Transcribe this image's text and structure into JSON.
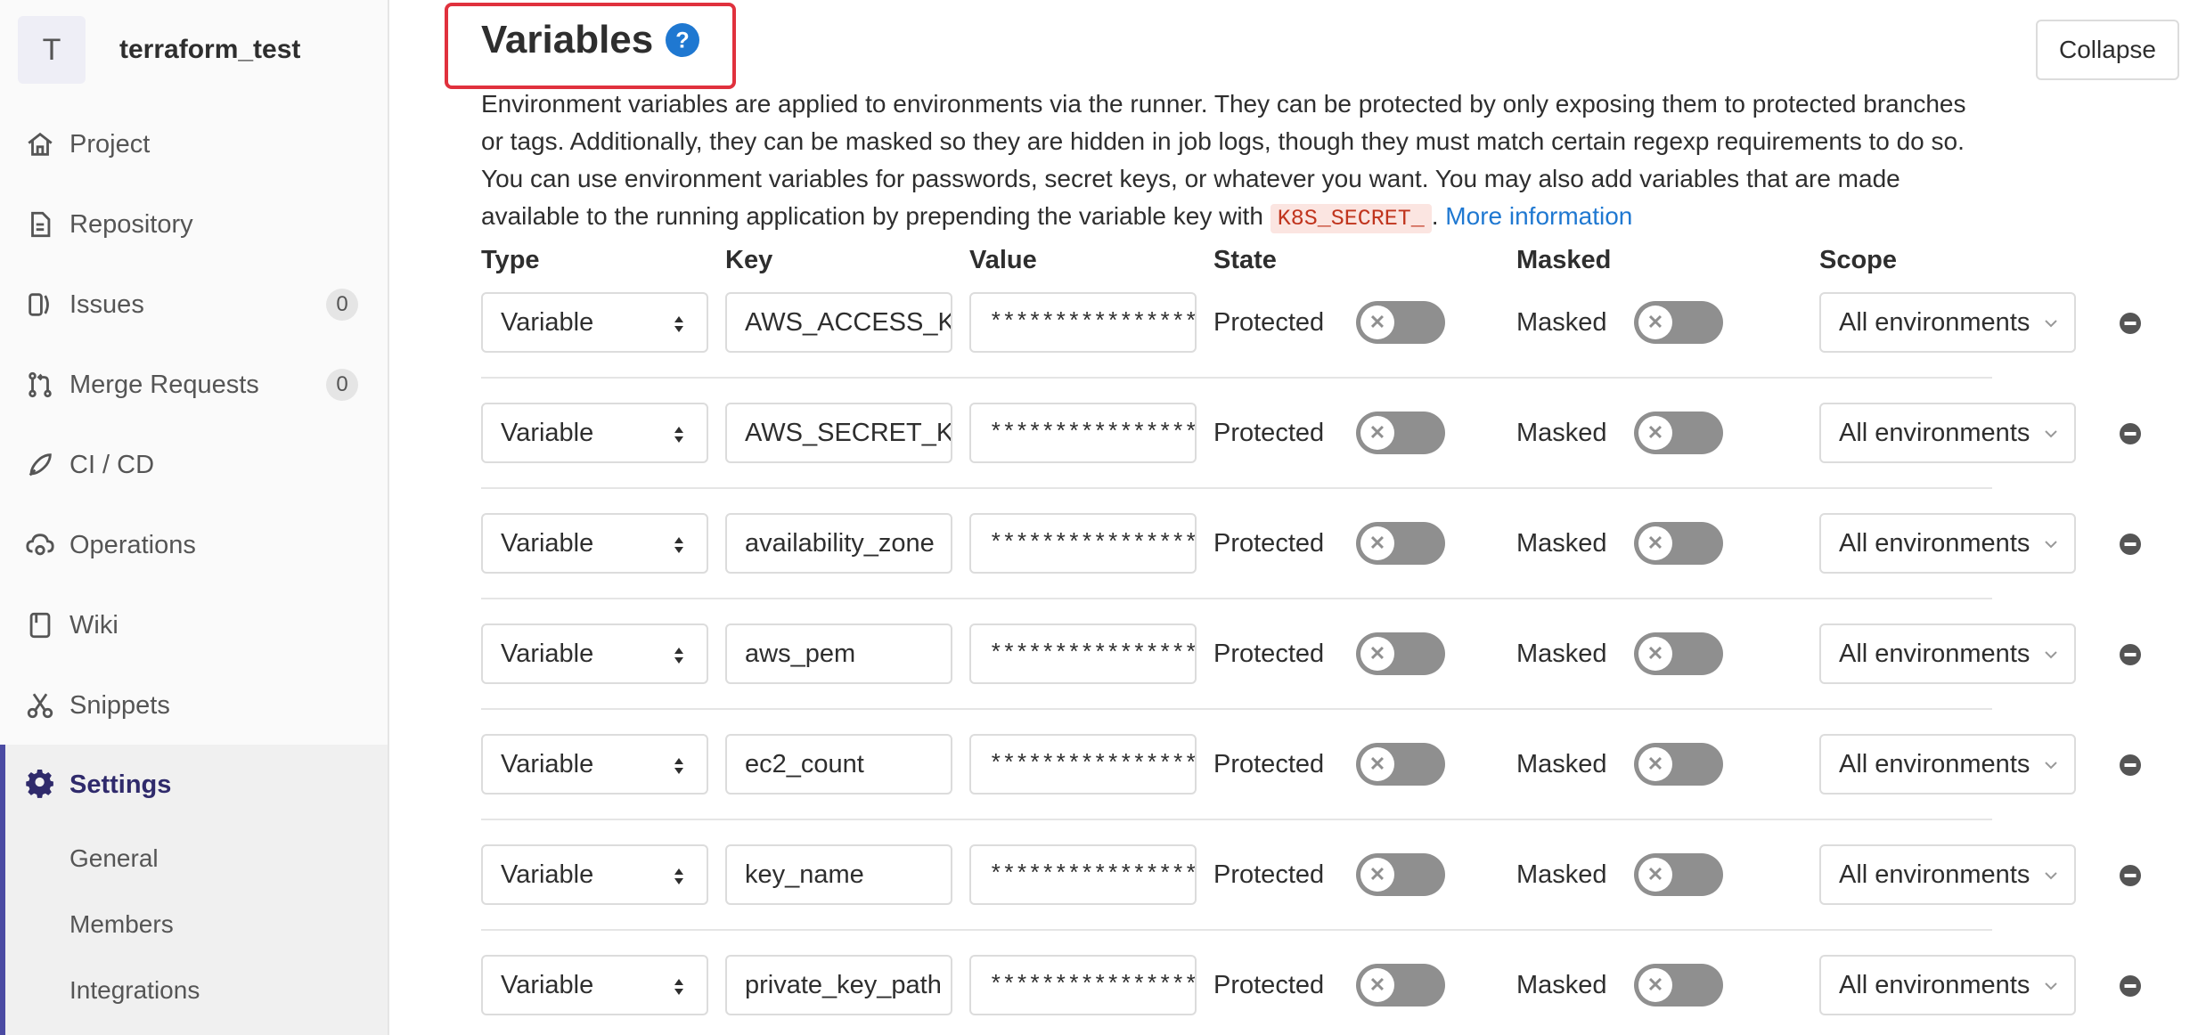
{
  "project": {
    "avatar_letter": "T",
    "name": "terraform_test"
  },
  "sidebar": {
    "items": [
      {
        "label": "Project",
        "icon": "home-icon"
      },
      {
        "label": "Repository",
        "icon": "document-icon"
      },
      {
        "label": "Issues",
        "icon": "issues-icon",
        "badge": "0"
      },
      {
        "label": "Merge Requests",
        "icon": "merge-request-icon",
        "badge": "0"
      },
      {
        "label": "CI / CD",
        "icon": "rocket-icon"
      },
      {
        "label": "Operations",
        "icon": "cloud-gear-icon"
      },
      {
        "label": "Wiki",
        "icon": "book-icon"
      },
      {
        "label": "Snippets",
        "icon": "scissors-icon"
      },
      {
        "label": "Settings",
        "icon": "gear-icon",
        "active": true
      }
    ],
    "sub_items": [
      "General",
      "Members",
      "Integrations"
    ]
  },
  "section": {
    "title": "Variables",
    "collapse_label": "Collapse",
    "desc_1": "Environment variables are applied to environments via the runner. They can be protected by only exposing them to protected branches or tags. Additionally, they can be masked so they are hidden in job logs, though they must match certain regexp requirements to do so. You can use environment variables for passwords, secret keys, or whatever you want. You may also add variables that are made available to the running application by prepending the variable key with ",
    "desc_code": "K8S_SECRET_",
    "desc_2": ". ",
    "more_info": "More information"
  },
  "columns": {
    "type": "Type",
    "key": "Key",
    "value": "Value",
    "state": "State",
    "masked": "Masked",
    "scope": "Scope"
  },
  "variables": [
    {
      "type": "Variable",
      "key": "AWS_ACCESS_KEY_ID",
      "value": "****************",
      "state": "Protected",
      "masked": "Masked",
      "protected_on": false,
      "masked_on": false,
      "scope": "All environments"
    },
    {
      "type": "Variable",
      "key": "AWS_SECRET_KEY",
      "value": "****************",
      "state": "Protected",
      "masked": "Masked",
      "protected_on": false,
      "masked_on": false,
      "scope": "All environments"
    },
    {
      "type": "Variable",
      "key": "availability_zone",
      "value": "****************",
      "state": "Protected",
      "masked": "Masked",
      "protected_on": false,
      "masked_on": false,
      "scope": "All environments"
    },
    {
      "type": "Variable",
      "key": "aws_pem",
      "value": "****************",
      "state": "Protected",
      "masked": "Masked",
      "protected_on": false,
      "masked_on": false,
      "scope": "All environments"
    },
    {
      "type": "Variable",
      "key": "ec2_count",
      "value": "****************",
      "state": "Protected",
      "masked": "Masked",
      "protected_on": false,
      "masked_on": false,
      "scope": "All environments"
    },
    {
      "type": "Variable",
      "key": "key_name",
      "value": "****************",
      "state": "Protected",
      "masked": "Masked",
      "protected_on": false,
      "masked_on": false,
      "scope": "All environments"
    },
    {
      "type": "Variable",
      "key": "private_key_path",
      "value": "****************",
      "state": "Protected",
      "masked": "Masked",
      "protected_on": false,
      "masked_on": false,
      "scope": "All environments"
    }
  ],
  "colors": {
    "accent": "#4b4ba3",
    "link": "#1f78d1",
    "highlight_border": "#e0313d",
    "toggle_off": "#8f8f8f"
  }
}
